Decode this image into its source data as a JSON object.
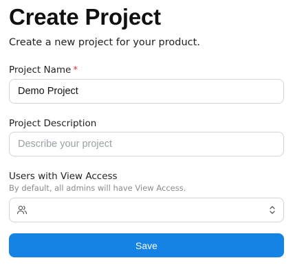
{
  "header": {
    "title": "Create Project",
    "subtitle": "Create a new project for your product."
  },
  "form": {
    "project_name": {
      "label": "Project Name",
      "required_marker": "*",
      "value": "Demo Project"
    },
    "project_description": {
      "label": "Project Description",
      "placeholder": "Describe your project",
      "value": ""
    },
    "view_access": {
      "label": "Users with View Access",
      "hint": "By default, all admins will have View Access.",
      "leading_icon": "users-icon",
      "trailing_icon": "chevron-up-down-icon",
      "selected": ""
    },
    "save_label": "Save"
  },
  "colors": {
    "primary_button": "#1583e3",
    "required_marker": "#e03131",
    "border": "#d0d4da",
    "hint_text": "#8a8a8a"
  }
}
